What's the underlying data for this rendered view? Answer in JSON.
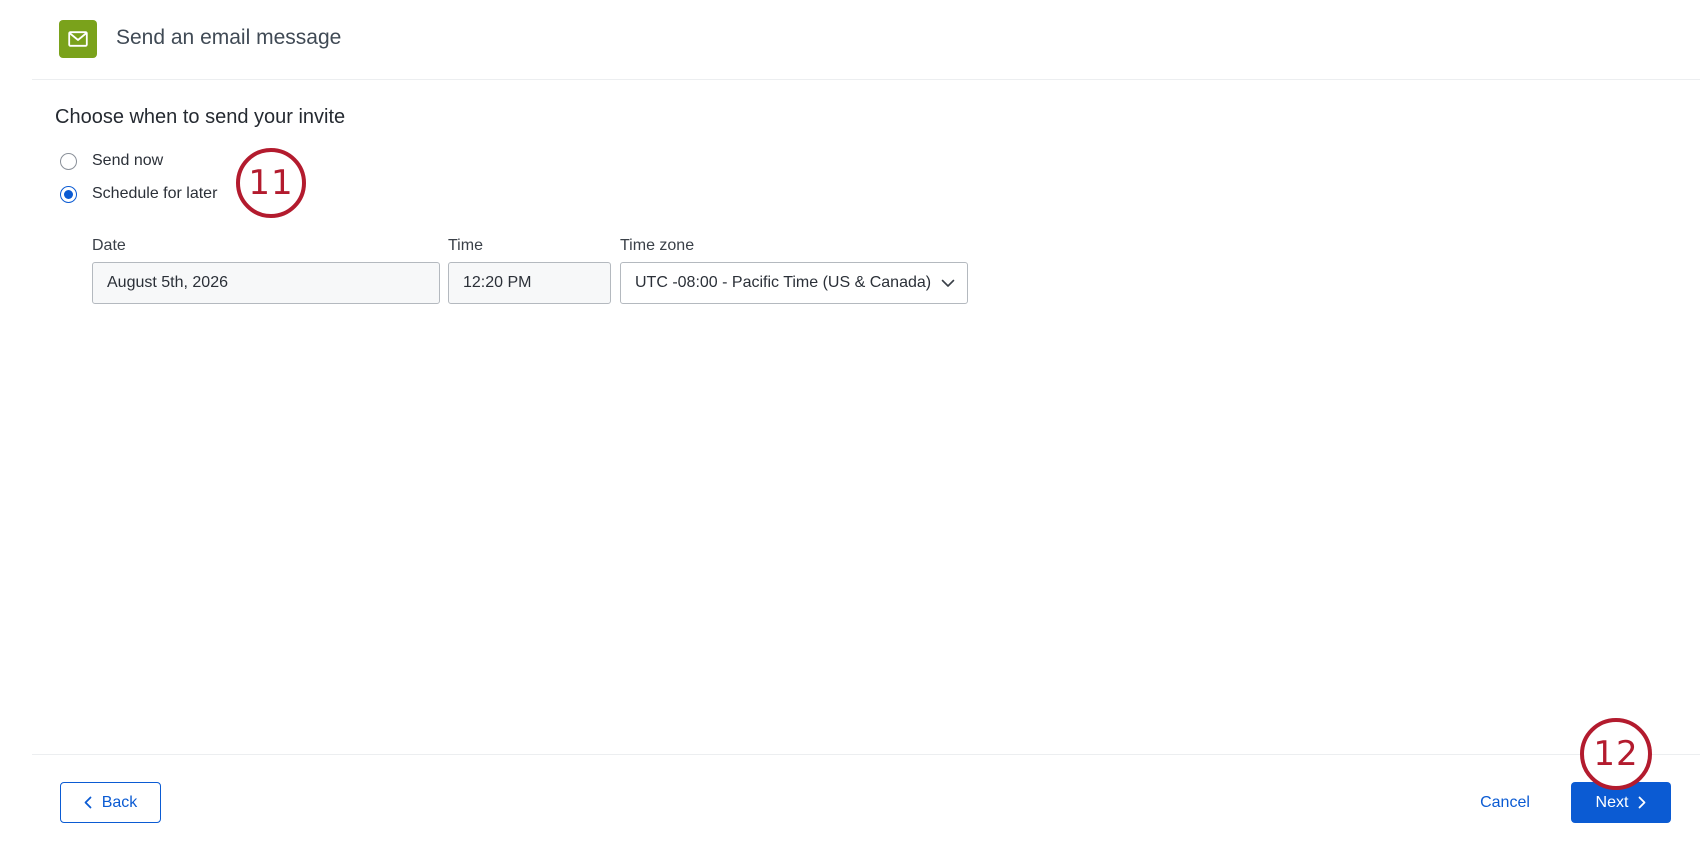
{
  "header": {
    "title": "Send an email message",
    "icon": "envelope-icon",
    "icon_bg": "#7aa21b"
  },
  "schedule": {
    "heading": "Choose when to send your invite",
    "options": [
      {
        "label": "Send now",
        "selected": false
      },
      {
        "label": "Schedule for later",
        "selected": true
      }
    ]
  },
  "fields": {
    "date": {
      "label": "Date",
      "value": "August 5th, 2026"
    },
    "time": {
      "label": "Time",
      "value": "12:20 PM"
    },
    "timezone": {
      "label": "Time zone",
      "value": "UTC -08:00 - Pacific Time (US & Canada)"
    }
  },
  "footer": {
    "back_label": "Back",
    "cancel_label": "Cancel",
    "next_label": "Next"
  },
  "annotations": {
    "step_11": "11",
    "step_12": "12"
  },
  "colors": {
    "accent": "#0b5bd3",
    "annotation": "#b31b2e"
  }
}
